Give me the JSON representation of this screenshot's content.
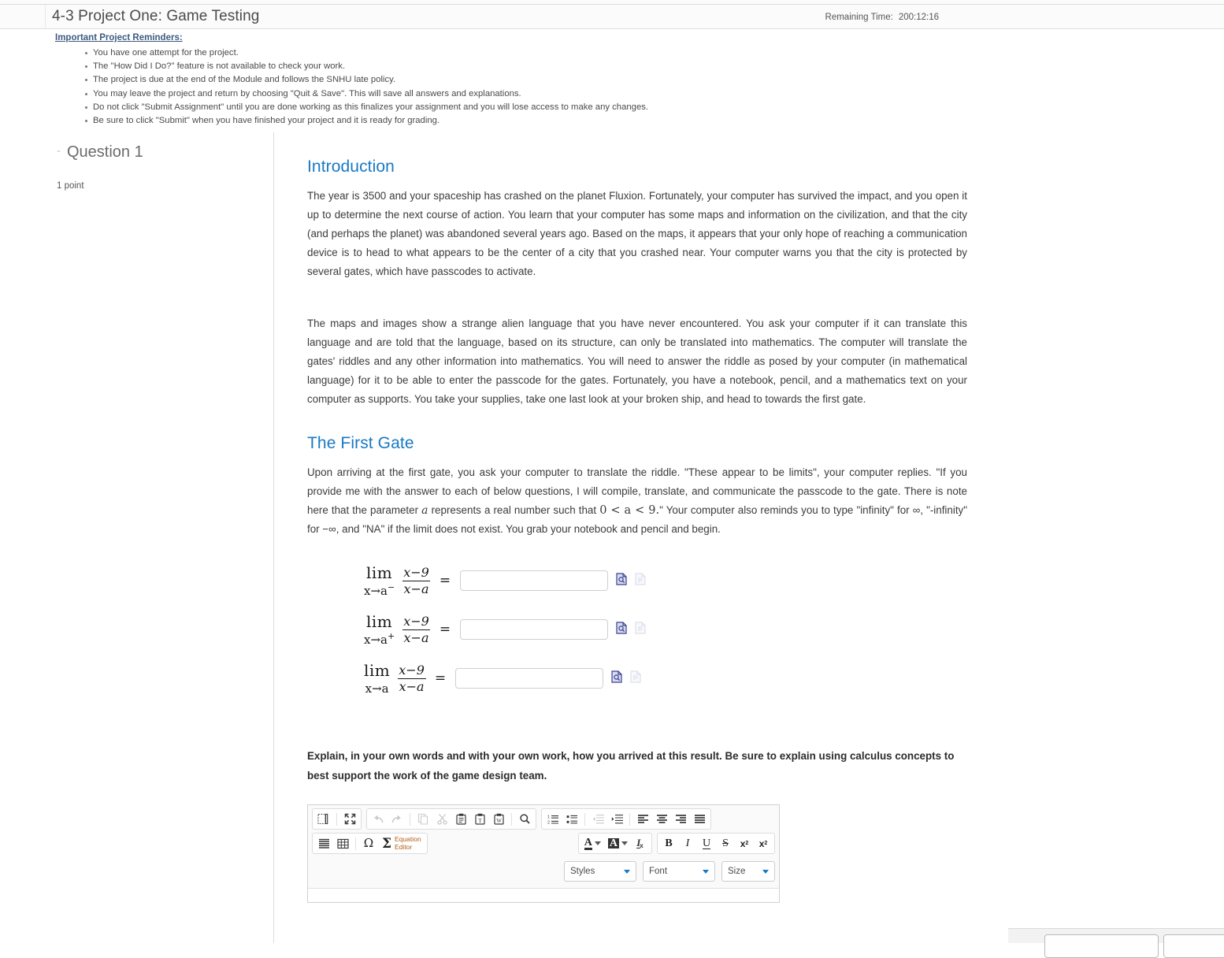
{
  "header": {
    "assessment_title": "4-3 Project One: Game Testing",
    "timer_label": "Remaining Time:",
    "timer_value": "200:12:16"
  },
  "reminders": {
    "title": "Important Project Reminders:",
    "items": [
      "You have one attempt for the project.",
      "The \"How Did I Do?\" feature is not available to check your work.",
      "The project is due at the end of the Module and follows the SNHU late policy.",
      "You may leave the project and return by choosing \"Quit & Save\". This will save all answers and explanations.",
      "Do not click \"Submit Assignment\" until you are done working as this finalizes your assignment and you will lose access to make any changes.",
      "Be sure to click \"Submit\" when you have finished your project and it is ready for grading."
    ]
  },
  "question_rail": {
    "collapse_toggle": "-",
    "title": "Question 1",
    "points": "1 point"
  },
  "main": {
    "intro_heading": "Introduction",
    "intro_paragraph_1": "The year is 3500 and your spaceship has crashed on the planet Fluxion. Fortunately, your computer has survived the impact, and you open it up to determine the next course of action. You learn that your computer has some maps and information on the civilization, and that the city (and perhaps the planet) was abandoned several years ago. Based on the maps, it appears that your only hope of reaching a communication device is to head to what appears to be the center of a city that you crashed near. Your computer warns you that the city is protected by several gates, which have passcodes to activate.",
    "intro_paragraph_2": "The maps and images show a strange alien language that you have never encountered. You ask your computer if it can translate this language and are told that the language, based on its structure, can only be translated into mathematics. The computer will translate the gates' riddles and any other information into mathematics. You will need to answer the riddle as posed by your computer (in mathematical language) for it to be able to enter the passcode for the gates. Fortunately, you have a notebook, pencil, and a mathematics text on your computer as supports. You take your supplies, take one last look at your broken ship, and head to towards the first gate.",
    "gate_heading": "The First Gate",
    "gate_text_a": "Upon arriving at the first gate, you ask your computer to translate the riddle. \"These appear to be limits\", your computer replies. \"If you provide me with the answer to each of below questions, I will compile, translate, and communicate the passcode to the gate. There is note here that the parameter ",
    "gate_param": "a",
    "gate_text_b": " represents a real number such that ",
    "gate_condition": "0 < a < 9.",
    "gate_text_c": "\" Your computer also reminds you to type \"infinity\" for ∞, \"-infinity\" for −∞, and \"NA\" if the limit does not exist. You grab your notebook and pencil and begin.",
    "explain_prompt": "Explain, in your own words and with your own work, how you arrived at this result. Be sure to explain using calculus concepts to best support the work of the game design team."
  },
  "limits": [
    {
      "lim_word": "lim",
      "approach": "x→a",
      "side": "−",
      "num": "x−9",
      "den": "x−a",
      "equals": "=",
      "value": "",
      "placeholder": ""
    },
    {
      "lim_word": "lim",
      "approach": "x→a",
      "side": "+",
      "num": "x−9",
      "den": "x−a",
      "equals": "=",
      "value": "",
      "placeholder": ""
    },
    {
      "lim_word": "lim",
      "approach": "x→a",
      "side": "",
      "num": "x−9",
      "den": "x−a",
      "equals": "=",
      "value": "",
      "placeholder": ""
    }
  ],
  "editor": {
    "toolbar_row1_group1": [
      "templates-icon",
      "maximize-icon"
    ],
    "toolbar_row1_group2": [
      "undo-icon",
      "redo-icon",
      "copy-icon",
      "cut-icon",
      "paste-icon",
      "paste-text-icon",
      "paste-word-icon",
      "find-icon"
    ],
    "toolbar_row1_group3": [
      "numbered-list-icon",
      "bulleted-list-icon",
      "outdent-icon",
      "indent-icon",
      "align-left-icon",
      "align-center-icon",
      "align-right-icon",
      "justify-icon"
    ],
    "toolbar_row2_group1": [
      "blockquote-icon",
      "table-icon",
      "special-character-icon"
    ],
    "equation_editor_line1": "Equation",
    "equation_editor_line2": "Editor",
    "toolbar_row2_group2": [
      "text-color-icon",
      "background-color-icon",
      "remove-format-icon"
    ],
    "toolbar_row2_group3": [
      "bold-icon",
      "italic-icon",
      "underline-icon",
      "strikethrough-icon",
      "subscript-icon",
      "superscript-icon"
    ],
    "bold_label": "B",
    "italic_label": "I",
    "underline_label": "U",
    "strike_label": "S",
    "subscript_label": "x",
    "subscript_index": "2",
    "superscript_label": "x",
    "superscript_index": "2",
    "text_color_label": "A",
    "bg_color_label": "A",
    "remove_format_label": "I",
    "dropdown_styles": "Styles",
    "dropdown_font": "Font",
    "dropdown_size": "Size"
  },
  "colors": {
    "heading_blue": "#1979c3",
    "caret_blue": "#1979c3",
    "equation_orange": "#b45f17",
    "reminder_title": "#3d5a80",
    "body_text": "#3b3b3b"
  }
}
